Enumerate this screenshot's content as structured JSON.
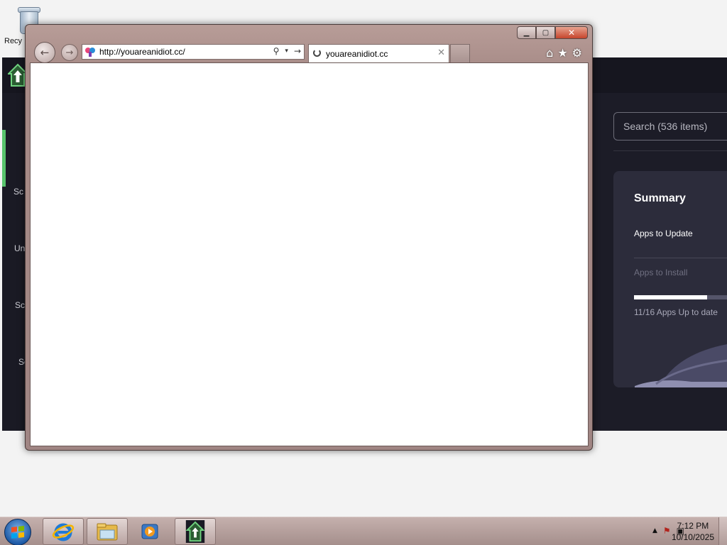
{
  "desktop": {
    "recycle_bin_label": "Recy"
  },
  "background_app": {
    "sidebar_items": [
      "Sc",
      "Un",
      "Sci",
      "Se"
    ],
    "search_placeholder": "Search (536 items)",
    "summary": {
      "title": "Summary",
      "apps_to_update": "Apps to Update",
      "apps_to_install": "Apps to Install",
      "up_to_date_text": "11/16 Apps Up to date",
      "progress_fraction": 0.6875
    },
    "accent_color": "#57c46b"
  },
  "browser": {
    "url": "http://youareanidiot.cc/",
    "tab_title": "youareanidiot.cc",
    "controls": {
      "minimize": "minimize-icon",
      "maximize": "maximize-icon",
      "close": "close-icon"
    },
    "toolbar_icons": [
      "home-icon",
      "star-icon",
      "gear-icon"
    ]
  },
  "taskbar": {
    "pinned": [
      "internet-explorer-icon",
      "file-explorer-icon",
      "media-player-icon",
      "app-store-icon"
    ],
    "clock_time": "7:12 PM",
    "clock_date": "10/10/2025"
  }
}
